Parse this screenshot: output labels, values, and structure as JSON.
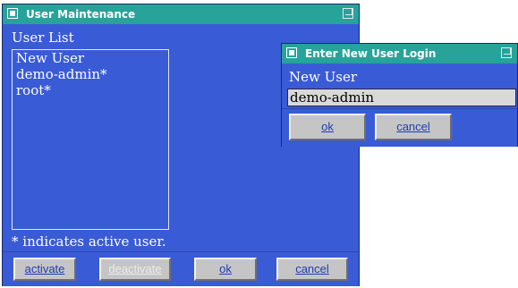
{
  "main_window": {
    "title": "User Maintenance",
    "list_label": "User List",
    "users": [
      "New User",
      "demo-admin*",
      "root*"
    ],
    "footnote": "* indicates active user.",
    "buttons": {
      "activate": "activate",
      "deactivate": "deactivate",
      "ok": "ok",
      "cancel": "cancel"
    }
  },
  "login_dialog": {
    "title": "Enter New User Login",
    "field_label": "New User",
    "field_value": "demo-admin",
    "buttons": {
      "ok": "ok",
      "cancel": "cancel"
    }
  },
  "colors": {
    "window_bg": "#3a5bd6",
    "titlebar": "#27a39a",
    "button_face": "#c5c5c5"
  }
}
